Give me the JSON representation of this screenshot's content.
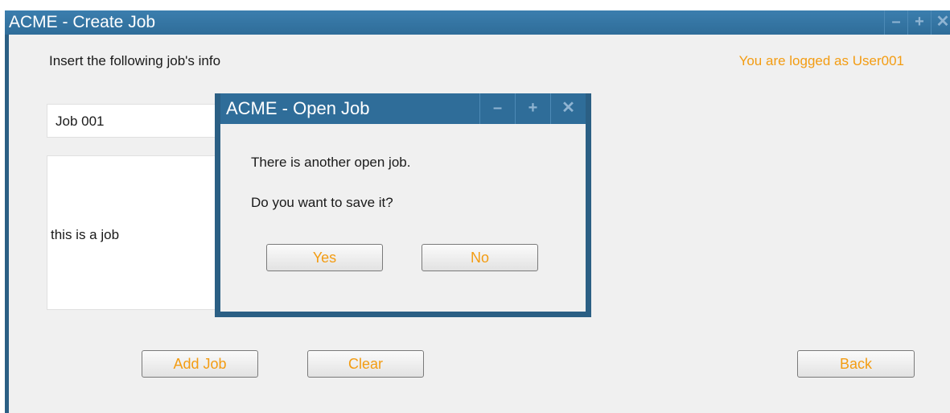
{
  "window": {
    "title": "ACME - Create Job",
    "controls": {
      "minimize": "–",
      "maximize": "+",
      "close": "✕"
    }
  },
  "form": {
    "intro": "Insert the following job's info",
    "logged_user": "You are logged as User001",
    "job_name_value": "Job 001",
    "job_description_value": "this is a job"
  },
  "buttons": {
    "add_job": "Add Job",
    "clear": "Clear",
    "back": "Back"
  },
  "dialog": {
    "title": "ACME - Open Job",
    "message_line1": "There is another open job.",
    "message_line2": "Do you want to save it?",
    "yes": "Yes",
    "no": "No",
    "controls": {
      "minimize": "–",
      "maximize": "+",
      "close": "✕"
    }
  },
  "colors": {
    "titlebar": "#2f6d99",
    "accent_text": "#f39c12",
    "window_bg": "#f0f0f0"
  }
}
